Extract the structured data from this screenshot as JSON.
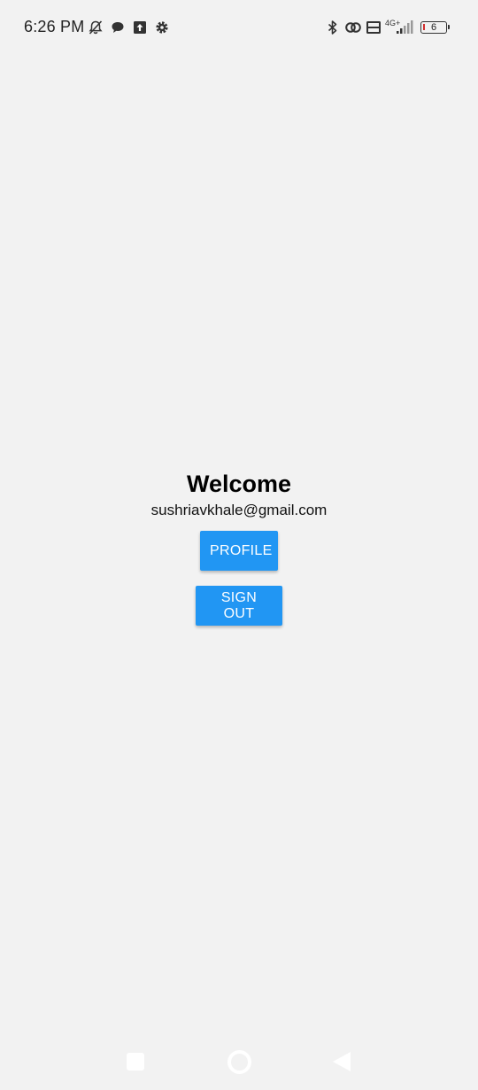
{
  "status_bar": {
    "time": "6:26 PM",
    "network_label": "4G+",
    "battery_level": "6",
    "icons": [
      "bell-off-icon",
      "chat-bubble-icon",
      "upload-icon",
      "settings-gear-icon",
      "bluetooth-icon",
      "link-icon",
      "volte-icon",
      "signal-icon",
      "battery-icon"
    ]
  },
  "main": {
    "title": "Welcome",
    "email": "sushriavkhale@gmail.com",
    "profile_button": "PROFILE",
    "signout_button": "SIGN OUT"
  },
  "colors": {
    "background": "#f2f2f2",
    "button": "#2196f3",
    "button_text": "#ffffff",
    "battery_low": "#d32f2f"
  },
  "nav_bar": {
    "icons": [
      "recents-icon",
      "home-icon",
      "back-icon"
    ]
  }
}
